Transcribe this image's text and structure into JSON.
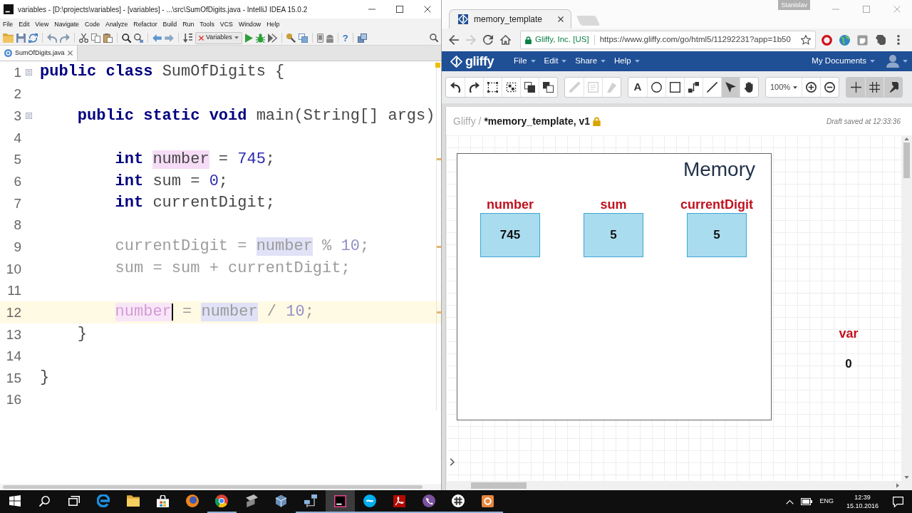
{
  "ide": {
    "title": "variables - [D:\\projects\\variables] - [variables] - ...\\src\\SumOfDigits.java - IntelliJ IDEA 15.0.2",
    "menu": [
      "File",
      "Edit",
      "View",
      "Navigate",
      "Code",
      "Analyze",
      "Refactor",
      "Build",
      "Run",
      "Tools",
      "VCS",
      "Window",
      "Help"
    ],
    "run_configuration": "Variables",
    "help_label": "?",
    "editor_tabs": [
      {
        "label": "SumOfDigits.java",
        "selected": true
      }
    ],
    "code": [
      {
        "number": "1",
        "foldable": true,
        "dimmed": false,
        "current": false,
        "tokens": [
          {
            "text": "public class",
            "kind": "keyword"
          },
          {
            "text": " SumOfDigits {",
            "kind": "plain"
          }
        ],
        "children": [
          {
            "number": "2",
            "foldable": false,
            "current": false
          },
          {
            "number": "3",
            "foldable": true,
            "dimmed": false,
            "current": false,
            "tokens": [
              {
                "text": "public static void",
                "kind": "keyword"
              },
              {
                "text": " main(String[] args)",
                "kind": "plain"
              }
            ],
            "children": [
              {
                "number": "4",
                "foldable": false,
                "current": false
              },
              {
                "number": "5",
                "foldable": false,
                "dimmed": false,
                "current": false,
                "tokens": [
                  {
                    "text": "int ",
                    "kind": "keyword"
                  },
                  {
                    "text": "number",
                    "kind": "write_usage"
                  },
                  {
                    "text": " = ",
                    "kind": "plain"
                  },
                  {
                    "text": "745",
                    "kind": "number"
                  },
                  {
                    "text": ";",
                    "kind": "plain"
                  }
                ]
              },
              {
                "number": "6",
                "foldable": false,
                "dimmed": false,
                "current": false,
                "tokens": [
                  {
                    "text": "int ",
                    "kind": "keyword"
                  },
                  {
                    "text": "sum = ",
                    "kind": "plain"
                  },
                  {
                    "text": "0",
                    "kind": "number"
                  },
                  {
                    "text": ";",
                    "kind": "plain"
                  }
                ]
              },
              {
                "number": "7",
                "foldable": false,
                "dimmed": false,
                "current": false,
                "tokens": [
                  {
                    "text": "int ",
                    "kind": "keyword"
                  },
                  {
                    "text": "currentDigit;",
                    "kind": "plain"
                  }
                ]
              },
              {
                "number": "8",
                "foldable": false,
                "current": false
              },
              {
                "number": "9",
                "foldable": false,
                "dimmed": true,
                "current": false,
                "tokens": [
                  {
                    "text": "currentDigit = ",
                    "kind": "plain"
                  },
                  {
                    "text": "number",
                    "kind": "read_usage"
                  },
                  {
                    "text": " % ",
                    "kind": "plain"
                  },
                  {
                    "text": "10",
                    "kind": "number"
                  },
                  {
                    "text": ";",
                    "kind": "plain"
                  }
                ]
              },
              {
                "number": "10",
                "foldable": false,
                "dimmed": true,
                "current": false,
                "tokens": [
                  {
                    "text": "sum = sum + currentDigit;",
                    "kind": "plain"
                  }
                ]
              },
              {
                "number": "11",
                "foldable": false,
                "current": false
              },
              {
                "number": "12",
                "foldable": false,
                "dimmed": true,
                "current": true,
                "tokens": [
                  {
                    "text": "number",
                    "kind": "write_usage",
                    "caret": true
                  },
                  {
                    "text": " = ",
                    "kind": "plain"
                  },
                  {
                    "text": "number",
                    "kind": "read_usage"
                  },
                  {
                    "text": " / ",
                    "kind": "plain"
                  },
                  {
                    "text": "10",
                    "kind": "number"
                  },
                  {
                    "text": ";",
                    "kind": "plain"
                  }
                ]
              }
            ]
          },
          {
            "number": "13",
            "foldable": false,
            "dimmed": false,
            "current": false,
            "tokens": [
              {
                "text": "}",
                "kind": "plain"
              }
            ]
          },
          {
            "number": "14",
            "foldable": false,
            "current": false
          }
        ]
      },
      {
        "number": "15",
        "foldable": false,
        "dimmed": false,
        "current": false,
        "tokens": [
          {
            "text": "}",
            "kind": "plain"
          }
        ]
      },
      {
        "number": "16",
        "foldable": false,
        "current": false
      }
    ]
  },
  "browser": {
    "tabs": [
      {
        "title": "memory_template",
        "selected": true
      }
    ],
    "profile": "Stanislav",
    "nav": [
      {
        "kind": "back",
        "disabled": false
      },
      {
        "kind": "forward",
        "disabled": true
      },
      {
        "kind": "reload",
        "disabled": false
      },
      {
        "kind": "home",
        "disabled": false
      }
    ],
    "site_identity": "Gliffy, Inc. [US]",
    "url": "https://www.gliffy.com/go/html5/11292231?app=1b50"
  },
  "gliffy": {
    "logo": "gliffy",
    "menu": [
      "File",
      "Edit",
      "Share",
      "Help"
    ],
    "documents_menu": "My Documents",
    "tool_groups": [
      [
        {
          "kind": "undo",
          "selected": false,
          "disabled": false
        },
        {
          "kind": "redo",
          "selected": false,
          "disabled": false
        },
        {
          "kind": "select-area",
          "selected": false,
          "disabled": false
        },
        {
          "kind": "group",
          "selected": false,
          "disabled": false
        },
        {
          "kind": "bring-front",
          "selected": false,
          "disabled": false
        },
        {
          "kind": "send-back",
          "selected": false,
          "disabled": false
        }
      ],
      [
        {
          "kind": "pencil",
          "selected": false,
          "disabled": true
        },
        {
          "kind": "note",
          "selected": false,
          "disabled": true
        },
        {
          "kind": "brush",
          "selected": false,
          "disabled": true
        }
      ],
      [
        {
          "kind": "text",
          "label": "A",
          "selected": false,
          "disabled": false
        },
        {
          "kind": "ellipse",
          "selected": false,
          "disabled": false
        },
        {
          "kind": "rectangle",
          "selected": false,
          "disabled": false
        },
        {
          "kind": "connector",
          "selected": false,
          "disabled": false
        },
        {
          "kind": "line",
          "selected": false,
          "disabled": false
        },
        {
          "kind": "pointer",
          "selected": true,
          "disabled": false
        },
        {
          "kind": "hand",
          "selected": false,
          "disabled": false
        }
      ],
      [
        {
          "kind": "zoom-level",
          "label": "100%",
          "selected": false,
          "disabled": false
        },
        {
          "kind": "zoom-in",
          "selected": false,
          "disabled": false
        },
        {
          "kind": "zoom-out",
          "selected": false,
          "disabled": false
        }
      ],
      [
        {
          "kind": "crosshair",
          "selected": true,
          "disabled": false
        },
        {
          "kind": "grid",
          "selected": true,
          "disabled": false
        },
        {
          "kind": "pin",
          "selected": true,
          "disabled": false
        }
      ]
    ],
    "breadcrumb": "Gliffy /",
    "document_title": "*memory_template, v1",
    "locked": true,
    "save_status": "Draft saved at 12:33:36",
    "canvas": {
      "frame": {
        "title": "Memory",
        "variables": [
          {
            "name": "number",
            "value": "745"
          },
          {
            "name": "sum",
            "value": "5"
          },
          {
            "name": "currentDigit",
            "value": "5"
          }
        ]
      },
      "loose_variables": [
        {
          "name": "var",
          "value": "0"
        }
      ]
    }
  },
  "taskbar": {
    "apps": [
      {
        "kind": "edge",
        "running": false,
        "selected": false
      },
      {
        "kind": "folder",
        "running": false,
        "selected": false
      },
      {
        "kind": "store",
        "running": false,
        "selected": false
      },
      {
        "kind": "fox",
        "running": false,
        "selected": false
      },
      {
        "kind": "wheel",
        "running": true,
        "selected": false
      },
      {
        "kind": "scanner",
        "running": false,
        "selected": false
      },
      {
        "kind": "cube",
        "running": false,
        "selected": false
      },
      {
        "kind": "network",
        "running": true,
        "selected": false
      },
      {
        "kind": "ide",
        "running": true,
        "selected": true
      },
      {
        "kind": "chat",
        "running": true,
        "selected": false
      },
      {
        "kind": "pdf",
        "running": true,
        "selected": false
      },
      {
        "kind": "phone",
        "running": true,
        "selected": false
      },
      {
        "kind": "hash",
        "running": true,
        "selected": false
      },
      {
        "kind": "orange-app",
        "running": true,
        "selected": false
      }
    ],
    "language": "ENG",
    "time": "12:39",
    "date": "15.10.2016"
  }
}
